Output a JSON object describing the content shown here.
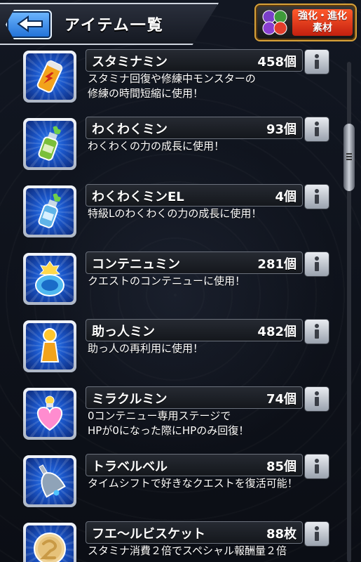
{
  "header": {
    "title": "アイテム一覧",
    "evolve_button": {
      "line1": "強化・進化",
      "line2": "素材"
    }
  },
  "colors": {
    "accent_blue": "#1f6fd6",
    "icon_bg": "#1a55c8",
    "evolve_red": "#c3200f"
  },
  "items": [
    {
      "name": "スタミナミン",
      "count": "458個",
      "desc1": "スタミナ回復や修練中モンスターの",
      "desc2": "修練の時間短縮に使用！",
      "icon": "stamina-can-icon"
    },
    {
      "name": "わくわくミン",
      "count": "93個",
      "desc1": "わくわくの力の成長に使用！",
      "desc2": "",
      "icon": "green-bottle-icon"
    },
    {
      "name": "わくわくミンEL",
      "count": "4個",
      "desc1": "特級Lのわくわくの力の成長に使用！",
      "desc2": "",
      "icon": "blue-bottle-icon"
    },
    {
      "name": "コンテニュミン",
      "count": "281個",
      "desc1": "クエストのコンテニューに使用！",
      "desc2": "",
      "icon": "continue-jar-icon"
    },
    {
      "name": "助っ人ミン",
      "count": "482個",
      "desc1": "助っ人の再利用に使用！",
      "desc2": "",
      "icon": "helper-peg-icon"
    },
    {
      "name": "ミラクルミン",
      "count": "74個",
      "desc1": "0コンテニュー専用ステージで",
      "desc2": "HPが0になった際にHPのみ回復！",
      "icon": "heart-potion-icon"
    },
    {
      "name": "トラベルベル",
      "count": "85個",
      "desc1": "タイムシフトで好きなクエストを復活可能！",
      "desc2": "",
      "icon": "bell-icon"
    },
    {
      "name": "フエ〜ルビスケット",
      "count": "88枚",
      "desc1": "スタミナ消費２倍でスペシャル報酬量２倍",
      "desc2": "",
      "icon": "biscuit-icon"
    }
  ]
}
